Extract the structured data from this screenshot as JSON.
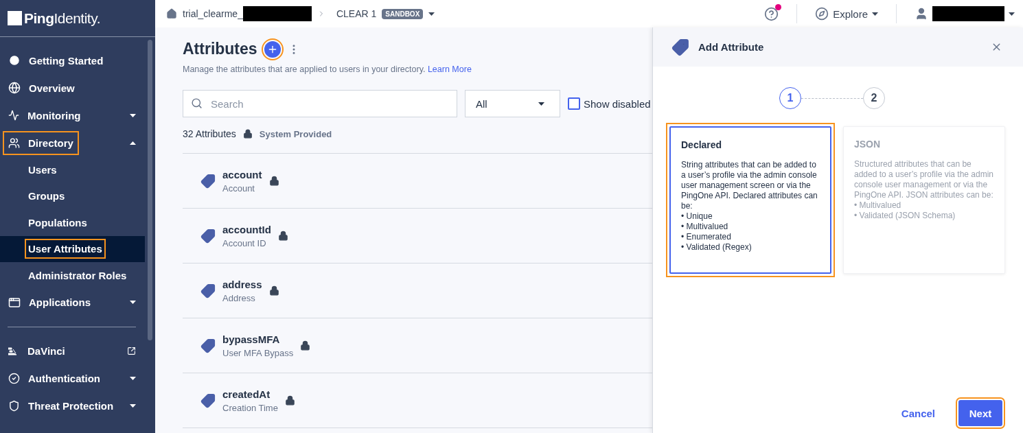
{
  "sidebar": {
    "logo": "**Ping**Identity.",
    "groups": [
      [
        {
          "label": "Getting Started",
          "kind": "link"
        },
        {
          "label": "Overview",
          "kind": "link"
        },
        {
          "label": "Monitoring",
          "kind": "group",
          "expanded": false
        },
        {
          "label": "Directory",
          "kind": "group",
          "expanded": true,
          "highlighted": true,
          "children": [
            {
              "label": "Users",
              "selected": false
            },
            {
              "label": "Groups",
              "selected": false
            },
            {
              "label": "Populations",
              "selected": false
            },
            {
              "label": "User Attributes",
              "selected": true,
              "highlighted": true
            },
            {
              "label": "Administrator Roles",
              "selected": false
            }
          ]
        },
        {
          "label": "Applications",
          "kind": "group",
          "expanded": false
        }
      ],
      [
        {
          "label": "DaVinci",
          "kind": "external"
        },
        {
          "label": "Authentication",
          "kind": "group",
          "expanded": false
        },
        {
          "label": "Threat Protection",
          "kind": "group",
          "expanded": false
        }
      ]
    ]
  },
  "topbar": {
    "breadcrumb": "trial_clearme_",
    "environment": "CLEAR 1",
    "badge": "SANDBOX",
    "help_notification": true,
    "explore": "Explore"
  },
  "page": {
    "title": "Attributes",
    "add_highlighted": true,
    "description": "Manage the attributes that are applied to users in your directory.",
    "learn_more": "Learn More",
    "search": {
      "placeholder": "Search"
    },
    "filter": "All",
    "show_disabled": {
      "label": "Show disabled",
      "checked": false
    },
    "count": "32 Attributes",
    "legend": "System Provided",
    "rows": [
      {
        "name": "account",
        "label": "Account",
        "locked": true
      },
      {
        "name": "accountId",
        "label": "Account ID",
        "locked": true
      },
      {
        "name": "address",
        "label": "Address",
        "locked": true
      },
      {
        "name": "bypassMFA",
        "label": "User MFA Bypass",
        "locked": true
      },
      {
        "name": "createdAt",
        "label": "Creation Time",
        "locked": true
      }
    ]
  },
  "panel": {
    "title": "Add Attribute",
    "steps": [
      {
        "label": "1",
        "selected": true
      },
      {
        "label": "2",
        "selected": false
      }
    ],
    "cards": [
      {
        "title": "Declared",
        "selected": true,
        "highlighted": true,
        "text": "String attributes that can be added to a user’s profile via the admin console user management screen or via the PingOne API. Declared attributes can be:",
        "bullets": [
          "• Unique",
          "• Multivalued",
          "• Enumerated",
          "• Validated (Regex)"
        ]
      },
      {
        "title": "JSON",
        "selected": false,
        "highlighted": false,
        "text": "Structured attributes that can be added to a user’s profile via the admin console user management or via the PingOne API. JSON attributes can be:",
        "bullets": [
          "• Multivalued",
          "• Validated (JSON Schema)"
        ]
      }
    ],
    "cancel": "Cancel",
    "next": "Next",
    "next_highlighted": true
  }
}
